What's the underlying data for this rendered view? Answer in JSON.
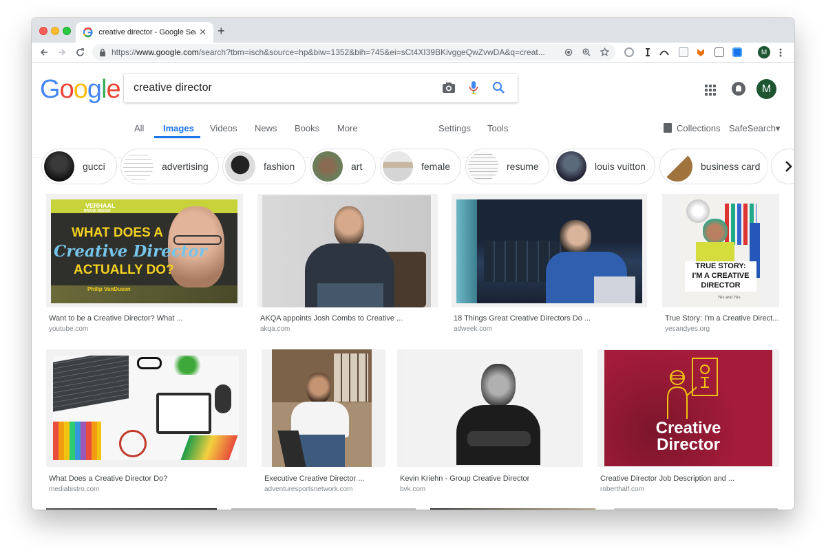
{
  "browser": {
    "tab_title": "creative director - Google Sear",
    "tab_close": "✕",
    "new_tab": "+",
    "url_prefix": "https://",
    "url_host": "www.google.com",
    "url_rest": "/search?tbm=isch&source=hp&biw=1352&bih=745&ei=sCt4XI39BKivggeQwZvwDA&q=creat...",
    "profile_initial": "M"
  },
  "google": {
    "logo": [
      "G",
      "o",
      "o",
      "g",
      "l",
      "e"
    ],
    "logo_colors": [
      "#4285f4",
      "#ea4335",
      "#fbbc05",
      "#4285f4",
      "#34a853",
      "#ea4335"
    ],
    "query": "creative director",
    "avatar_initial": "M"
  },
  "nav": {
    "tabs": [
      "All",
      "Images",
      "Videos",
      "News",
      "Books",
      "More"
    ],
    "active": "Images",
    "settings": "Settings",
    "tools": "Tools",
    "collections": "Collections",
    "safesearch": "SafeSearch▾"
  },
  "chips": [
    "gucci",
    "advertising",
    "fashion",
    "art",
    "female",
    "resume",
    "louis vuitton",
    "business card"
  ],
  "results": [
    {
      "caption": "Want to be a Creative Director? What ...",
      "source": "youtube.com"
    },
    {
      "caption": "AKQA appoints Josh Combs to Creative ...",
      "source": "akqa.com"
    },
    {
      "caption": "18 Things Great Creative Directors Do ...",
      "source": "adweek.com"
    },
    {
      "caption": "True Story: I'm a Creative Direct...",
      "source": "yesandyes.org"
    },
    {
      "caption": "What Does a Creative Director Do?",
      "source": "mediabistro.com"
    },
    {
      "caption": "Executive Creative Director ...",
      "source": "adventuresportsnetwork.com"
    },
    {
      "caption": "Kevin Kriehn - Group Creative Director",
      "source": "bvk.com"
    },
    {
      "caption": "Creative Director Job Description and ...",
      "source": "roberthalf.com"
    }
  ],
  "image_text": {
    "verhaal_brand": "VERHAAL",
    "verhaal_sub": "BRAND DESIGN",
    "verhaal_line1": "WHAT DOES A",
    "verhaal_line2": "Creative Director",
    "verhaal_line3": "ACTUALLY DO?",
    "verhaal_name": "Philip VanDusen",
    "truestory_line1": "TRUE STORY:",
    "truestory_line2": "I'M A CREATIVE",
    "truestory_line3": "DIRECTOR",
    "truestory_sig": "Yes and Yes",
    "rh_line1": "Creative",
    "rh_line2": "Director"
  }
}
